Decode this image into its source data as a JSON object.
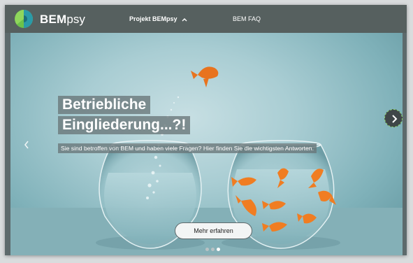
{
  "brand": {
    "name_bold": "BEM",
    "name_light": "psy",
    "logo_icon": "bempsy-logo-icon"
  },
  "nav": {
    "items": [
      {
        "label": "Projekt BEMpsy",
        "icon": "chevron-up-icon"
      },
      {
        "label": "BEM FAQ"
      }
    ]
  },
  "hero": {
    "title_line1": "Betriebliche",
    "title_line2": "Eingliederung...?!",
    "subtitle": "Sie sind betroffen von BEM und haben viele Fragen? Hier finden Sie die wichtigsten Antworten.",
    "cta_label": "Mehr erfahren",
    "prev_icon": "chevron-left-icon",
    "next_icon": "chevron-right-icon",
    "slide_count": 3,
    "active_slide": 3
  },
  "colors": {
    "navbar": "#56605f",
    "text_box": "#697678",
    "logo_green": "#6cc24a",
    "logo_teal": "#2a7e8a"
  }
}
